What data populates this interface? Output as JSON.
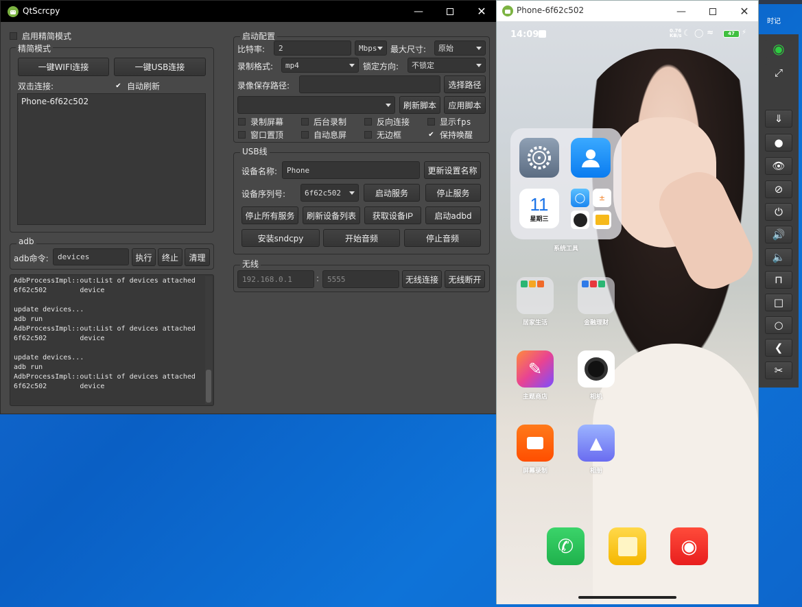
{
  "main_window": {
    "title": "QtScrcpy",
    "simple_mode_label": "启用精简模式",
    "simple_group": {
      "title": "精简模式",
      "wifi_button": "一键WIFI连接",
      "usb_button": "一键USB连接",
      "double_click_label": "双击连接:",
      "auto_refresh_label": "自动刷新",
      "auto_refresh_checked": true,
      "devices": [
        "Phone-6f62c502"
      ]
    },
    "adb_group": {
      "title": "adb",
      "cmd_label": "adb命令:",
      "cmd_value": "devices",
      "exec_button": "执行",
      "stop_button": "终止",
      "clear_button": "清理"
    },
    "log_text": "AdbProcessImpl::out:List of devices attached\n6f62c502\tdevice\n\nupdate devices...\nadb run\nAdbProcessImpl::out:List of devices attached\n6f62c502\tdevice\n\nupdate devices...\nadb run\nAdbProcessImpl::out:List of devices attached\n6f62c502\tdevice",
    "start_config": {
      "title": "启动配置",
      "bitrate_label": "比特率:",
      "bitrate_value": "2",
      "bitrate_unit": "Mbps",
      "max_size_label": "最大尺寸:",
      "max_size_value": "原始",
      "record_format_label": "录制格式:",
      "record_format_value": "mp4",
      "lock_orientation_label": "锁定方向:",
      "lock_orientation_value": "不锁定",
      "record_path_label": "录像保存路径:",
      "record_path_value": "",
      "select_path_button": "选择路径",
      "script_value": "",
      "refresh_script_button": "刷新脚本",
      "apply_script_button": "应用脚本",
      "options": [
        {
          "label": "录制屏幕",
          "checked": false
        },
        {
          "label": "后台录制",
          "checked": false
        },
        {
          "label": "反向连接",
          "checked": false
        },
        {
          "label": "显示fps",
          "checked": false
        },
        {
          "label": "窗口置顶",
          "checked": false
        },
        {
          "label": "自动息屏",
          "checked": false
        },
        {
          "label": "无边框",
          "checked": false
        },
        {
          "label": "保持唤醒",
          "checked": true
        }
      ]
    },
    "usb_group": {
      "title": "USB线",
      "device_name_label": "设备名称:",
      "device_name_value": "Phone",
      "update_name_button": "更新设置名称",
      "serial_label": "设备序列号:",
      "serial_value": "6f62c502",
      "start_service_button": "启动服务",
      "stop_service_button": "停止服务",
      "stop_all_button": "停止所有服务",
      "refresh_devices_button": "刷新设备列表",
      "get_ip_button": "获取设备IP",
      "start_adbd_button": "启动adbd",
      "install_sndcpy_button": "安装sndcpy",
      "start_audio_button": "开始音频",
      "stop_audio_button": "停止音频"
    },
    "wireless_group": {
      "title": "无线",
      "ip_placeholder": "192.168.0.1",
      "port_placeholder": "5555",
      "connect_button": "无线连接",
      "disconnect_button": "无线断开"
    }
  },
  "phone_window": {
    "title": "Phone-6f62c502",
    "status_time": "14:09",
    "status_speed": "0.76\nKB/s",
    "battery": "47",
    "folder_label": "系统工具",
    "calendar_day": "11",
    "calendar_weekday": "星期三",
    "apps": [
      {
        "label": "居家生活"
      },
      {
        "label": "金融理财"
      },
      {
        "label": "主题商店"
      },
      {
        "label": "相机"
      },
      {
        "label": "屏幕录制"
      },
      {
        "label": "相册"
      }
    ]
  },
  "desktop": {
    "corner_text": "时记"
  },
  "colors": {
    "window_bg": "#484848",
    "titlebar_bg": "#000000",
    "desktop_blue": "#0a5fc4",
    "toolbar_bg": "#3d3d3d"
  }
}
